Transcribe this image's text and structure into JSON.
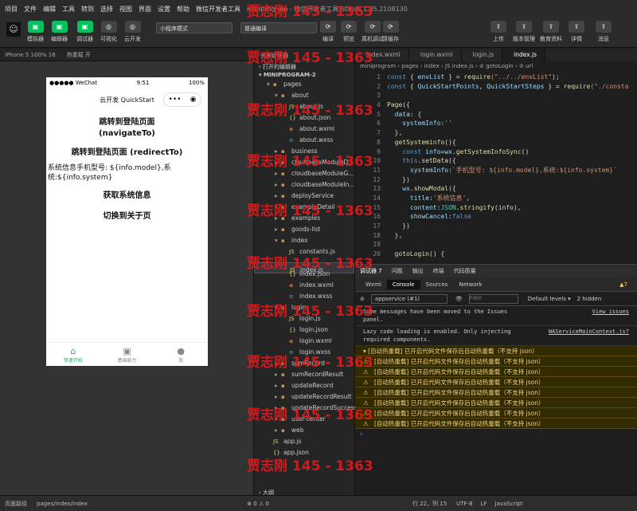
{
  "menubar": {
    "items": [
      "项目",
      "文件",
      "编辑",
      "工具",
      "转到",
      "选择",
      "视图",
      "界面",
      "设置",
      "帮助",
      "微信开发者工具"
    ],
    "window_title": "miniprogram - 微信开发者工具 Stable 1.05.2108130"
  },
  "toolbar": {
    "left_buttons": [
      "模拟器",
      "编辑器",
      "调试器",
      "可视化",
      "云开发"
    ],
    "mode_select": "小程序模式",
    "compile_select": "普通编译",
    "mid_buttons": [
      "编译",
      "预览",
      "真机调试",
      "清缓存"
    ],
    "right_buttons": [
      "上传",
      "版本管理",
      "教育资料",
      "详情",
      "消息"
    ]
  },
  "simulator": {
    "device": "iPhone 5 100% 16",
    "hotreload": "热重载 开",
    "status": {
      "carrier": "●●●●● WeChat",
      "time": "9:51",
      "battery": "100%"
    },
    "nav_title": "云开发 QuickStart",
    "capsule_more": "•••",
    "capsule_close": "◉",
    "buttons": [
      "跳转到登陆页面 (navigateTo)",
      "跳转到登陆页面 (redirectTo)"
    ],
    "info_text": "系统信息手机型号: ${info.model},系统:${info.system}",
    "buttons2": [
      "获取系统信息",
      "切换到关于页"
    ],
    "tabs": [
      {
        "icon": "⌂",
        "label": "快速开始",
        "color": "#07c160"
      },
      {
        "icon": "▣",
        "label": "基础能力",
        "color": "#888888"
      },
      {
        "icon": "●",
        "label": "我",
        "color": "#888888"
      }
    ]
  },
  "explorer": {
    "header": "资源管理器",
    "open_editors": "打开的编辑器",
    "project": "MINIPROGRAM-2",
    "items": [
      {
        "label": "pages",
        "indent": 1,
        "twisty": "▾",
        "icon": "▪",
        "icolor": "#c09553"
      },
      {
        "label": "about",
        "indent": 2,
        "twisty": "▾",
        "icon": "▪",
        "icolor": "#c09553"
      },
      {
        "label": "about.js",
        "indent": 3,
        "twisty": "",
        "icon": "JS",
        "icolor": "#e8d44d"
      },
      {
        "label": "about.json",
        "indent": 3,
        "twisty": "",
        "icon": "{}",
        "icolor": "#e8d44d"
      },
      {
        "label": "about.wxml",
        "indent": 3,
        "twisty": "",
        "icon": "◈",
        "icolor": "#e37933"
      },
      {
        "label": "about.wxss",
        "indent": 3,
        "twisty": "",
        "icon": "≡",
        "icolor": "#519aba"
      },
      {
        "label": "business",
        "indent": 2,
        "twisty": "▸",
        "icon": "▪",
        "icolor": "#c09553"
      },
      {
        "label": "cloudbaseModuleD...",
        "indent": 2,
        "twisty": "▸",
        "icon": "▪",
        "icolor": "#c09553"
      },
      {
        "label": "cloudbaseModuleG...",
        "indent": 2,
        "twisty": "▸",
        "icon": "▪",
        "icolor": "#c09553"
      },
      {
        "label": "cloudbaseModuleIn...",
        "indent": 2,
        "twisty": "▸",
        "icon": "▪",
        "icolor": "#c09553"
      },
      {
        "label": "deployService",
        "indent": 2,
        "twisty": "▸",
        "icon": "▪",
        "icolor": "#c09553"
      },
      {
        "label": "exampleDetail",
        "indent": 2,
        "twisty": "▸",
        "icon": "▪",
        "icolor": "#c09553"
      },
      {
        "label": "examples",
        "indent": 2,
        "twisty": "▸",
        "icon": "▪",
        "icolor": "#c09553"
      },
      {
        "label": "goods-list",
        "indent": 2,
        "twisty": "▸",
        "icon": "▪",
        "icolor": "#c09553"
      },
      {
        "label": "index",
        "indent": 2,
        "twisty": "▾",
        "icon": "▪",
        "icolor": "#c09553"
      },
      {
        "label": "constants.js",
        "indent": 3,
        "twisty": "",
        "icon": "JS",
        "icolor": "#e8d44d"
      },
      {
        "label": "index.js",
        "indent": 3,
        "twisty": "",
        "icon": "JS",
        "icolor": "#e8d44d",
        "selected": true
      },
      {
        "label": "index.json",
        "indent": 3,
        "twisty": "",
        "icon": "{}",
        "icolor": "#e8d44d"
      },
      {
        "label": "index.wxml",
        "indent": 3,
        "twisty": "",
        "icon": "◈",
        "icolor": "#e37933"
      },
      {
        "label": "index.wxss",
        "indent": 3,
        "twisty": "",
        "icon": "≡",
        "icolor": "#519aba"
      },
      {
        "label": "login",
        "indent": 2,
        "twisty": "▾",
        "icon": "▪",
        "icolor": "#c09553"
      },
      {
        "label": "login.js",
        "indent": 3,
        "twisty": "",
        "icon": "JS",
        "icolor": "#e8d44d"
      },
      {
        "label": "login.json",
        "indent": 3,
        "twisty": "",
        "icon": "{}",
        "icolor": "#e8d44d"
      },
      {
        "label": "login.wxml",
        "indent": 3,
        "twisty": "",
        "icon": "◈",
        "icolor": "#e37933"
      },
      {
        "label": "login.wxss",
        "indent": 3,
        "twisty": "",
        "icon": "≡",
        "icolor": "#519aba"
      },
      {
        "label": "sumRecord",
        "indent": 2,
        "twisty": "▸",
        "icon": "▪",
        "icolor": "#c09553"
      },
      {
        "label": "sumRecordResult",
        "indent": 2,
        "twisty": "▸",
        "icon": "▪",
        "icolor": "#c09553"
      },
      {
        "label": "updateRecord",
        "indent": 2,
        "twisty": "▸",
        "icon": "▪",
        "icolor": "#c09553"
      },
      {
        "label": "updateRecordResult",
        "indent": 2,
        "twisty": "▸",
        "icon": "▪",
        "icolor": "#c09553"
      },
      {
        "label": "updateRecordSuccess",
        "indent": 2,
        "twisty": "▸",
        "icon": "▪",
        "icolor": "#c09553"
      },
      {
        "label": "user-center",
        "indent": 2,
        "twisty": "▸",
        "icon": "▪",
        "icolor": "#c09553"
      },
      {
        "label": "web",
        "indent": 2,
        "twisty": "▸",
        "icon": "▪",
        "icolor": "#c09553"
      },
      {
        "label": "app.js",
        "indent": 1,
        "twisty": "",
        "icon": "JS",
        "icolor": "#e8d44d"
      },
      {
        "label": "app.json",
        "indent": 1,
        "twisty": "",
        "icon": "{}",
        "icolor": "#e8d44d"
      }
    ],
    "outline": "大纲",
    "errors": "⊗ 0 ⚠ 0"
  },
  "editor": {
    "tabs": [
      "index.wxml",
      "login.wxml",
      "login.js",
      "index.js"
    ],
    "active_tab": 3,
    "breadcrumb": "miniprogram › pages › index › JS index.js › ⊘ gotoLogin › ⊘ url",
    "lines": [
      [
        [
          "kw",
          "const "
        ],
        [
          "",
          "{ "
        ],
        [
          "prop",
          "envList"
        ],
        [
          "",
          " } = "
        ],
        [
          "fn",
          "require"
        ],
        [
          "str",
          "(\"../../envList\""
        ],
        [
          "",
          ");"
        ]
      ],
      [
        [
          "kw",
          "const "
        ],
        [
          "",
          "{ "
        ],
        [
          "prop",
          "QuickStartPoints"
        ],
        [
          "",
          ", "
        ],
        [
          "prop",
          "QuickStartSteps"
        ],
        [
          "",
          " } = "
        ],
        [
          "fn",
          "require"
        ],
        [
          "str",
          "(\"./consta"
        ]
      ],
      [
        [
          "",
          ""
        ]
      ],
      [
        [
          "fn",
          "Page"
        ],
        [
          "",
          "({"
        ]
      ],
      [
        [
          "",
          "  "
        ],
        [
          "prop",
          "data"
        ],
        [
          "",
          ": {"
        ]
      ],
      [
        [
          "",
          "    "
        ],
        [
          "prop",
          "systemInfo"
        ],
        [
          "",
          ":"
        ],
        [
          "str",
          "''"
        ]
      ],
      [
        [
          "",
          "  },"
        ]
      ],
      [
        [
          "",
          "  "
        ],
        [
          "fn",
          "getSysteminfo"
        ],
        [
          "",
          "(){"
        ]
      ],
      [
        [
          "",
          "    "
        ],
        [
          "kw",
          "const "
        ],
        [
          "prop",
          "info"
        ],
        [
          "",
          "="
        ],
        [
          "prop",
          "wx"
        ],
        [
          "",
          "."
        ],
        [
          "fn",
          "getSystemInfoSync"
        ],
        [
          "",
          "()"
        ]
      ],
      [
        [
          "",
          "    "
        ],
        [
          "kw",
          "this"
        ],
        [
          "",
          "."
        ],
        [
          "fn",
          "setData"
        ],
        [
          "",
          "({"
        ]
      ],
      [
        [
          "",
          "      "
        ],
        [
          "prop",
          "systemInfo"
        ],
        [
          "",
          ":"
        ],
        [
          "str",
          "`手机型号: ${info.model},系统:${info.system}`"
        ]
      ],
      [
        [
          "",
          "    })"
        ]
      ],
      [
        [
          "",
          "    "
        ],
        [
          "prop",
          "wx"
        ],
        [
          "",
          "."
        ],
        [
          "fn",
          "showModal"
        ],
        [
          "",
          "({"
        ]
      ],
      [
        [
          "",
          "      "
        ],
        [
          "prop",
          "title"
        ],
        [
          "",
          ":"
        ],
        [
          "str",
          "'系统信息'"
        ],
        [
          "",
          ","
        ]
      ],
      [
        [
          "",
          "      "
        ],
        [
          "prop",
          "content"
        ],
        [
          "",
          ":"
        ],
        [
          "grn",
          "JSON"
        ],
        [
          "",
          "."
        ],
        [
          "fn",
          "stringify"
        ],
        [
          "",
          "(info),"
        ]
      ],
      [
        [
          "",
          "      "
        ],
        [
          "prop",
          "showCancel"
        ],
        [
          "",
          ":"
        ],
        [
          "kw",
          "false"
        ]
      ],
      [
        [
          "",
          "    })"
        ]
      ],
      [
        [
          "",
          "  },"
        ]
      ],
      [
        [
          "",
          ""
        ]
      ],
      [
        [
          "",
          "  "
        ],
        [
          "fn",
          "gotoLogin"
        ],
        [
          "",
          "() {"
        ]
      ]
    ]
  },
  "console": {
    "top_tabs": [
      "调试器 7",
      "问题",
      "输出",
      "终端",
      "代码质量"
    ],
    "tabs": [
      "Wxml",
      "Console",
      "Sources",
      "Network"
    ],
    "active_tab": 1,
    "badge": "▲7",
    "context": "appservice (#1)",
    "filter_placeholder": "Filter",
    "levels": "Default levels ▾",
    "hidden": "2 hidden",
    "messages": [
      {
        "text": "Some messages have been moved to the Issues panel.",
        "link": "View issues"
      },
      {
        "text": "Lazy code loading is enabled. Only injecting required components.",
        "link": "WAServiceMainContext.js?"
      }
    ],
    "group": "▾ [自动热重载] 已开启代码文件保存后自动热重载（不支持 json）",
    "warnings": [
      "[自动热重载] 已开启代码文件保存后自动热重载（不支持 json）",
      "[自动热重载] 已开启代码文件保存后自动热重载（不支持 json）",
      "[自动热重载] 已开启代码文件保存后自动热重载（不支持 json）",
      "[自动热重载] 已开启代码文件保存后自动热重载（不支持 json）",
      "[自动热重载] 已开启代码文件保存后自动热重载（不支持 json）",
      "[自动热重载] 已开启代码文件保存后自动热重载（不支持 json）",
      "[自动热重载] 已开启代码文件保存后自动热重载（不支持 json）"
    ],
    "prompt": "›"
  },
  "statusbar": {
    "path_label": "页面路径",
    "path": "pages/index/index",
    "position": "行 22，列 15",
    "encoding": "UTF-8",
    "lf": "LF",
    "lang": "JavaScript"
  },
  "watermark": "贾志刚 145 - 1363"
}
